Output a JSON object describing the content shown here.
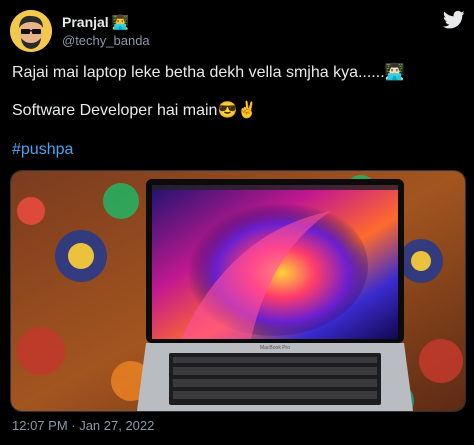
{
  "author": {
    "name": "Pranjal",
    "name_emoji": "👨‍💻",
    "handle": "@techy_banda"
  },
  "tweet": {
    "line1": "Rajai mai laptop leke betha dekh vella smjha kya......👨🏻‍💻",
    "line2": "Software Developer hai main😎✌️",
    "hashtag": "#pushpa"
  },
  "media": {
    "laptop_brand": "MacBook Pro"
  },
  "footer": {
    "timestamp": "12:07 PM · Jan 27, 2022"
  },
  "colors": {
    "background": "#000000",
    "text": "#e7e9ea",
    "secondary": "#8b98a5",
    "link": "#4aa3f0",
    "twitter_bird": "#e7e9ea"
  },
  "icons": {
    "logo": "twitter-bird-icon"
  }
}
